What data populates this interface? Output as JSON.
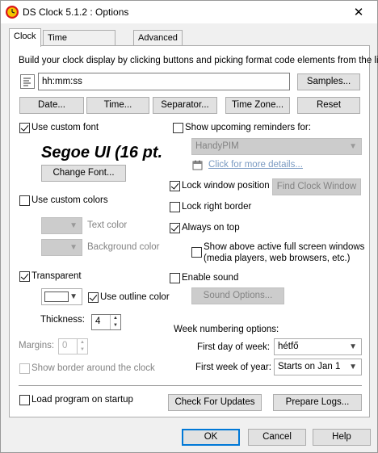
{
  "window": {
    "title": "DS Clock 5.1.2 : Options",
    "close_glyph": "✕"
  },
  "tabs": [
    {
      "label": "Clock",
      "active": true
    },
    {
      "label": "Time Synchronization",
      "active": false
    },
    {
      "label": "Advanced",
      "active": false
    }
  ],
  "intro": "Build your clock display by clicking buttons and picking format code elements from the list",
  "format": {
    "value": "hh:mm:ss",
    "samples_label": "Samples..."
  },
  "format_buttons": {
    "date": "Date...",
    "time": "Time...",
    "separator": "Separator...",
    "timezone": "Time Zone...",
    "reset": "Reset"
  },
  "font": {
    "use_custom_label": "Use custom font",
    "use_custom_checked": true,
    "sample": "Segoe UI (16 pt.",
    "change_label": "Change Font..."
  },
  "colors": {
    "use_custom_label": "Use custom colors",
    "use_custom_checked": false,
    "text_color_label": "Text color",
    "background_color_label": "Background color"
  },
  "transparency": {
    "transparent_label": "Transparent",
    "transparent_checked": true,
    "use_outline_label": "Use outline color",
    "use_outline_checked": true,
    "thickness_label": "Thickness:",
    "thickness_value": "4",
    "margins_label": "Margins:",
    "margins_value": "0",
    "show_border_label": "Show border around the clock",
    "show_border_checked": false
  },
  "reminders": {
    "show_label": "Show upcoming reminders for:",
    "show_checked": false,
    "source": "HandyPIM",
    "more_details": "Click for more details..."
  },
  "window_options": {
    "lock_position_label": "Lock window position",
    "lock_position_checked": true,
    "find_clock_label": "Find Clock Window",
    "lock_right_label": "Lock right border",
    "lock_right_checked": false,
    "always_on_top_label": "Always on top",
    "always_on_top_checked": true,
    "show_above_line1": "Show above active full screen windows",
    "show_above_line2": "(media players, web browsers, etc.)",
    "show_above_checked": false
  },
  "sound": {
    "enable_label": "Enable sound",
    "enable_checked": false,
    "options_label": "Sound Options..."
  },
  "week": {
    "heading": "Week numbering options:",
    "first_day_label": "First day of week:",
    "first_day_value": "hétfő",
    "first_week_label": "First week of year:",
    "first_week_value": "Starts on Jan 1"
  },
  "bottom": {
    "load_startup_label": "Load program on startup",
    "load_startup_checked": false,
    "check_updates_label": "Check For Updates",
    "prepare_logs_label": "Prepare Logs..."
  },
  "dialog_buttons": {
    "ok": "OK",
    "cancel": "Cancel",
    "help": "Help"
  },
  "colors_palette": {
    "accent": "#0078d7",
    "link": "#7a9ac2",
    "icon_red": "#d9161b",
    "icon_yellow": "#f5c400"
  }
}
